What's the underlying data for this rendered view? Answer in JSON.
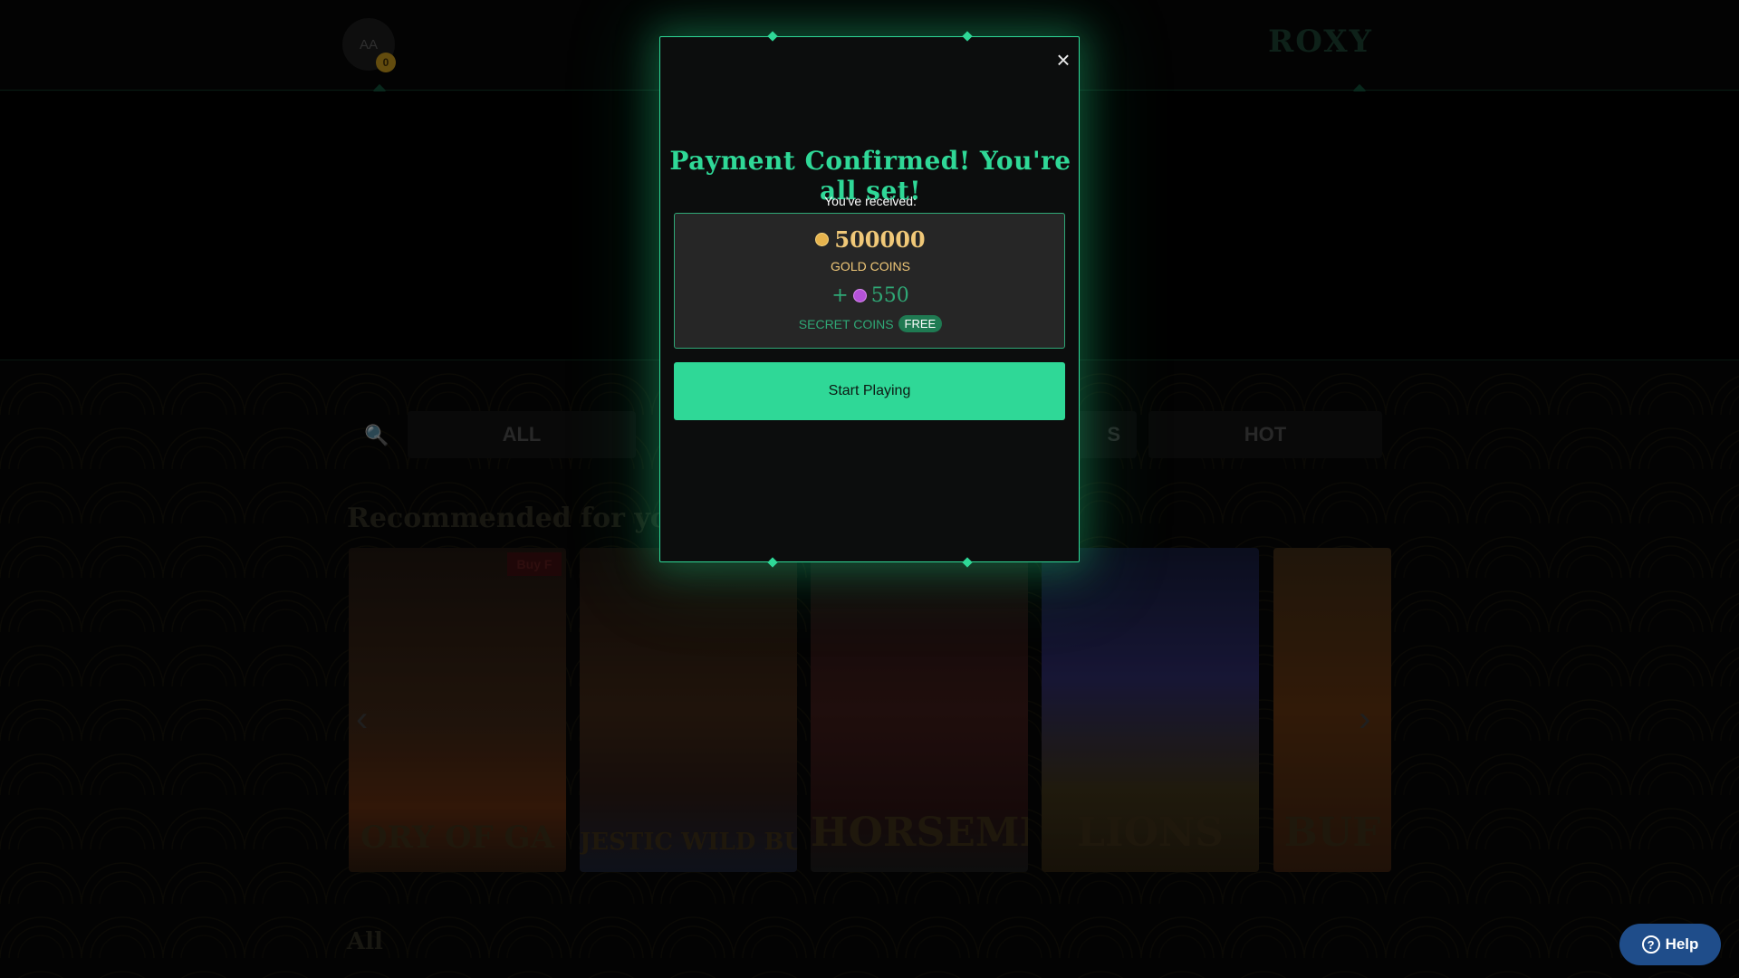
{
  "header": {
    "avatar_initials": "AA",
    "avatar_badge": "0",
    "logo_text": "ROXY"
  },
  "categories": {
    "search_icon": "🔍",
    "tabs": [
      "ALL",
      "S",
      "HOT"
    ]
  },
  "sections": {
    "recommended": "Recommended for you",
    "all": "All"
  },
  "games": [
    {
      "title": "ORY OF GA"
    },
    {
      "title": "JESTIC WILD BUFFA"
    },
    {
      "title": "HORSEMEN"
    },
    {
      "title": "LIONS"
    },
    {
      "title": "BUF"
    }
  ],
  "game_badge": "Buy F",
  "modal": {
    "title": "Payment Confirmed! You're all set!",
    "received_label": "You've received:",
    "gold_amount": "500000",
    "gold_label": "GOLD COINS",
    "secret_prefix": "+",
    "secret_amount": "550",
    "secret_label": "SECRET COINS",
    "free_badge": "FREE",
    "start_button": "Start Playing",
    "close_icon": "×"
  },
  "help": {
    "label": "Help",
    "icon": "?"
  },
  "colors": {
    "accent": "#2fd897",
    "gold": "#f0c878",
    "secret_coin": "#b452d8",
    "help_bg": "#1f4d8a"
  }
}
